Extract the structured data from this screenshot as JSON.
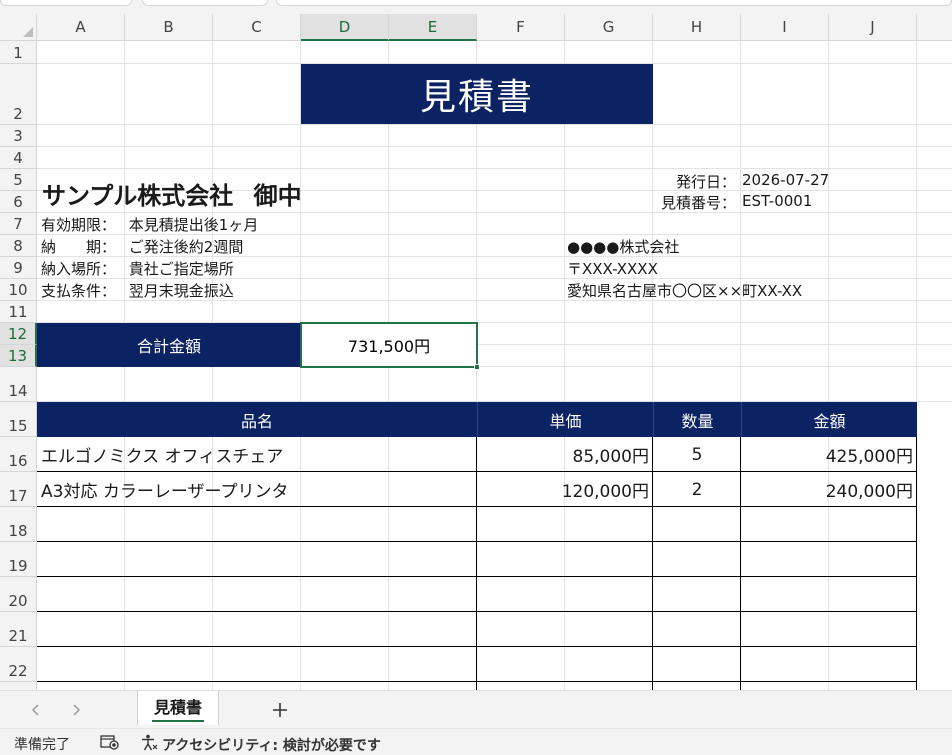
{
  "columns": [
    "A",
    "B",
    "C",
    "D",
    "E",
    "F",
    "G",
    "H",
    "I",
    "J"
  ],
  "rows": [
    "1",
    "2",
    "3",
    "4",
    "5",
    "6",
    "7",
    "8",
    "9",
    "10",
    "11",
    "12",
    "13",
    "14",
    "15",
    "16",
    "17",
    "18",
    "19",
    "20",
    "21",
    "22"
  ],
  "sheet": {
    "title": "見積書",
    "client": "サンプル株式会社",
    "honorific": "御中",
    "terms": [
      {
        "label": "有効期限：",
        "value": "本見積提出後1ヶ月"
      },
      {
        "label": "納　　期：",
        "value": "ご発注後約2週間"
      },
      {
        "label": "納入場所：",
        "value": "貴社ご指定場所"
      },
      {
        "label": "支払条件：",
        "value": "翌月末現金振込"
      }
    ],
    "issue_date_label": "発行日：",
    "issue_date": "2026-07-27",
    "estimate_no_label": "見積番号：",
    "estimate_no": "EST-0001",
    "issuer_name": "●●●●株式会社",
    "issuer_postal": "〒XXX-XXXX",
    "issuer_address": "愛知県名古屋市〇〇区××町XX-XX",
    "total_label": "合計金額",
    "total_value": "731,500円",
    "table_headers": {
      "name": "品名",
      "unit_price": "単価",
      "qty": "数量",
      "amount": "金額"
    },
    "items": [
      {
        "name": "エルゴノミクス オフィスチェア",
        "unit_price": "85,000円",
        "qty": "5",
        "amount": "425,000円"
      },
      {
        "name": "A3対応 カラーレーザープリンタ",
        "unit_price": "120,000円",
        "qty": "2",
        "amount": "240,000円"
      }
    ]
  },
  "tabs": {
    "prev_icon": "chevron-left-icon",
    "next_icon": "chevron-right-icon",
    "active_sheet": "見積書",
    "add_icon": "plus-icon"
  },
  "status": {
    "ready": "準備完了",
    "accessibility": "アクセシビリティ: 検討が必要です"
  },
  "colors": {
    "header_navy": "#0b2263",
    "select_green": "#217346"
  }
}
